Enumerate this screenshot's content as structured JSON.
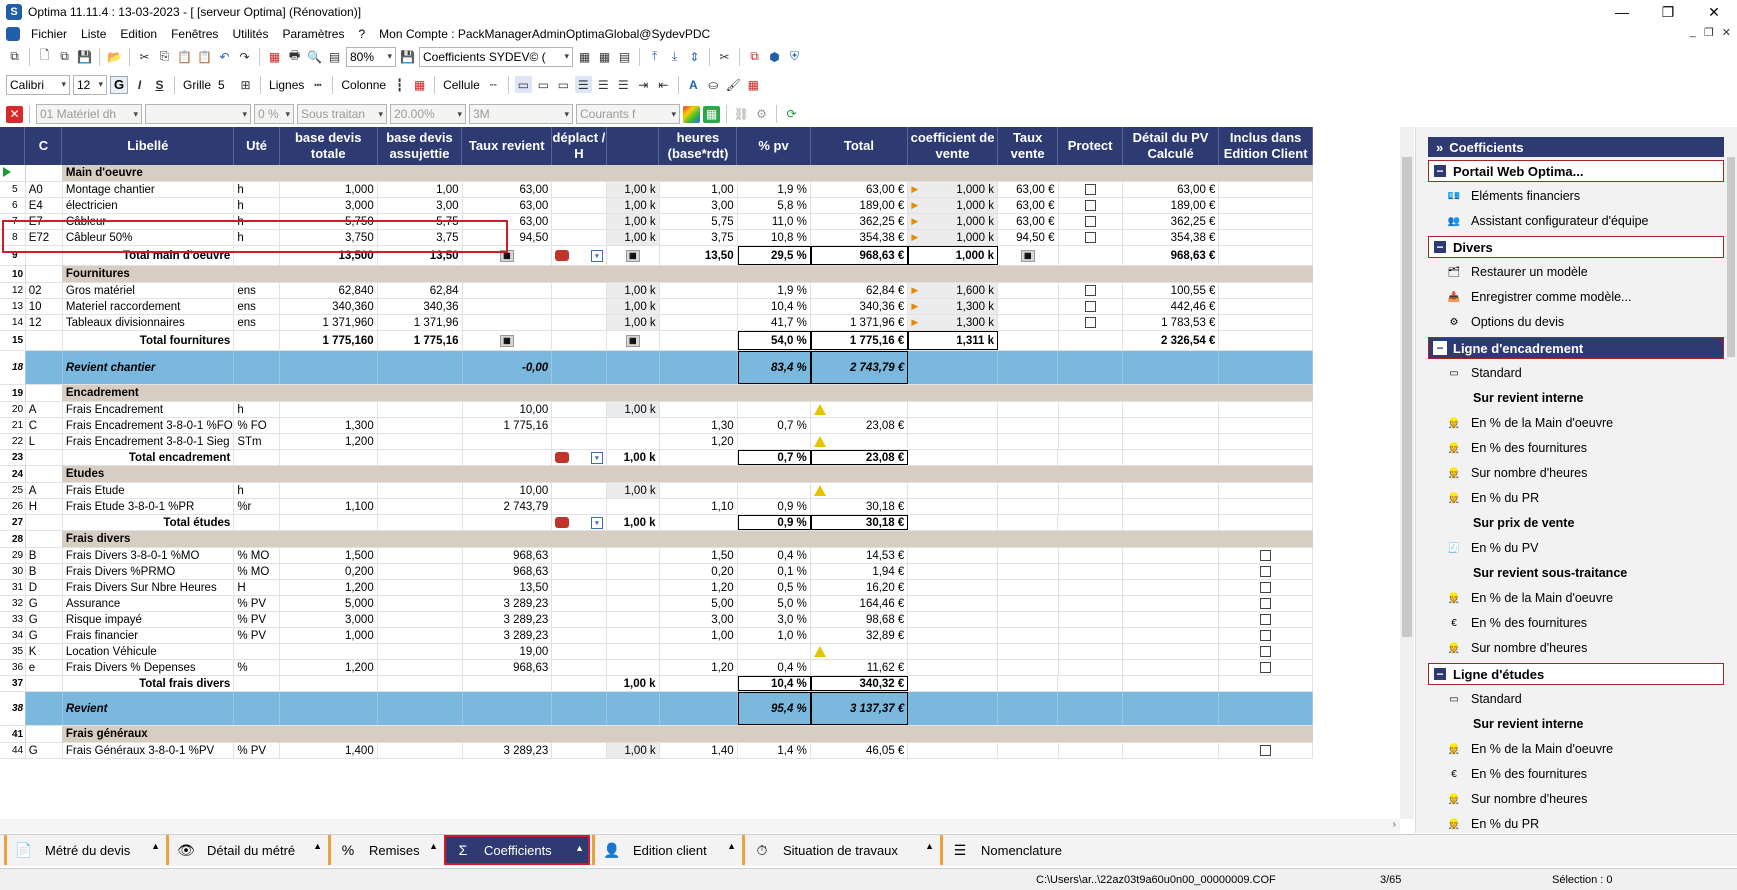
{
  "window": {
    "title": "Optima 11.11.4 : 13-03-2023 - [ [serveur Optima] (Rénovation)]"
  },
  "menu": [
    "Fichier",
    "Liste",
    "Edition",
    "Fenêtres",
    "Utilités",
    "Paramètres",
    "?"
  ],
  "account": "Mon Compte : PackManagerAdminOptimaGlobal@SydevPDC",
  "toolbar1": {
    "zoom": "80%",
    "coef_combo": "Coefficients  SYDEV© ("
  },
  "toolbar2": {
    "font": "Calibri",
    "size": "12",
    "bold": "G",
    "italic": "I",
    "underline": "S",
    "grille": "Grille",
    "grille_val": "5",
    "lignes": "Lignes",
    "colonne": "Colonne",
    "cellule": "Cellule"
  },
  "toolbar3": {
    "c1": "01  Matériel dh",
    "c2": "",
    "c3": "0 %",
    "c4": "Sous traitan",
    "c5": "20.00%",
    "c6": "3M",
    "c7": "Courants f"
  },
  "columns": [
    "C",
    "Libellé",
    "Uté",
    "base devis totale",
    "base devis assujettie",
    "Taux revient",
    "déplact / H",
    "",
    "heures (base*rdt)",
    "% pv",
    "Total",
    "coefficient de vente",
    "Taux vente",
    "Protect",
    "Détail du PV Calculé",
    "Inclus dans Edition Client"
  ],
  "rows": [
    {
      "n": "",
      "type": "sec",
      "c": "",
      "lib": "Main d'oeuvre"
    },
    {
      "n": "5",
      "c": "A0",
      "lib": " Montage chantier",
      "ute": "h",
      "bdt": "1,000",
      "bda": "1,00",
      "tr": "63,00",
      "k": "1,00 k",
      "hr": "1,00",
      "pv": "1,9 %",
      "tot": "63,00 €",
      "cv": "1,000 k",
      "tv": "63,00 €",
      "prot": true,
      "det": "63,00 €"
    },
    {
      "n": "6",
      "c": "E4",
      "lib": " électricien",
      "ute": "h",
      "bdt": "3,000",
      "bda": "3,00",
      "tr": "63,00",
      "k": "1,00 k",
      "hr": "3,00",
      "pv": "5,8 %",
      "tot": "189,00 €",
      "cv": "1,000 k",
      "tv": "63,00 €",
      "prot": true,
      "det": "189,00 €"
    },
    {
      "n": "7",
      "c": "E7",
      "lib": " Câbleur",
      "ute": "h",
      "bdt": "5,750",
      "bda": "5,75",
      "tr": "63,00",
      "k": "1,00 k",
      "hr": "5,75",
      "pv": "11,0 %",
      "tot": "362,25 €",
      "cv": "1,000 k",
      "tv": "63,00 €",
      "prot": true,
      "det": "362,25 €"
    },
    {
      "n": "8",
      "c": "E72",
      "lib": " Câbleur 50%",
      "ute": "h",
      "bdt": "3,750",
      "bda": "3,75",
      "tr": "94,50",
      "k": "1,00 k",
      "hr": "3,75",
      "pv": "10,8 %",
      "tot": "354,38 €",
      "cv": "1,000 k",
      "tv": "94,50 €",
      "prot": true,
      "det": "354,38 €"
    },
    {
      "n": "9",
      "type": "tot",
      "lib": "Total main d'oeuvre",
      "bdt": "13,500",
      "bda": "13,50",
      "hr": "13,50",
      "pv": "29,5 %",
      "tot": "968,63 €",
      "cv": "1,000 k",
      "det": "968,63 €"
    },
    {
      "n": "10",
      "type": "sec",
      "lib": "Fournitures"
    },
    {
      "n": "12",
      "c": "02",
      "lib": " Gros matériel",
      "ute": "ens",
      "bdt": "62,840",
      "bda": "62,84",
      "k": "1,00 k",
      "pv": "1,9 %",
      "tot": "62,84 €",
      "cv": "1,600 k",
      "prot": true,
      "det": "100,55 €"
    },
    {
      "n": "13",
      "c": "10",
      "lib": " Materiel raccordement",
      "ute": "ens",
      "bdt": "340,360",
      "bda": "340,36",
      "k": "1,00 k",
      "pv": "10,4 %",
      "tot": "340,36 €",
      "cv": "1,300 k",
      "prot": true,
      "det": "442,46 €"
    },
    {
      "n": "14",
      "c": "12",
      "lib": " Tableaux divisionnaires",
      "ute": "ens",
      "bdt": "1 371,960",
      "bda": "1 371,96",
      "k": "1,00 k",
      "pv": "41,7 %",
      "tot": "1 371,96 €",
      "cv": "1,300 k",
      "prot": true,
      "det": "1 783,53 €"
    },
    {
      "n": "15",
      "type": "tot",
      "lib": "Total fournitures",
      "bdt": "1 775,160",
      "bda": "1 775,16",
      "pv": "54,0 %",
      "tot": "1 775,16 €",
      "cv": "1,311 k",
      "det": "2 326,54 €"
    },
    {
      "n": "18",
      "type": "blue",
      "lib": "Revient chantier",
      "tr": "-0,00",
      "pv": "83,4 %",
      "tot": "2 743,79 €"
    },
    {
      "n": "19",
      "type": "sec",
      "lib": "Encadrement"
    },
    {
      "n": "20",
      "c": "A",
      "lib": "Frais Encadrement",
      "ute": "h",
      "tr": "10,00",
      "k": "1,00 k",
      "warn": true
    },
    {
      "n": "21",
      "c": "C",
      "lib": "Frais Encadrement 3-8-0-1 %FO",
      "ute": "% FO",
      "bdt": "1,300",
      "tr": "1 775,16",
      "hr": "1,30",
      "pv": "0,7 %",
      "tot": "23,08 €"
    },
    {
      "n": "22",
      "c": "L",
      "lib": "Frais Encadrement 3-8-0-1 Sieg",
      "ute": "STm",
      "bdt": "1,200",
      "hr": "1,20",
      "warn": true
    },
    {
      "n": "23",
      "type": "tot2",
      "lib": "Total encadrement",
      "k": "1,00 k",
      "pv": "0,7 %",
      "tot": "23,08 €"
    },
    {
      "n": "24",
      "type": "sec",
      "lib": "Etudes"
    },
    {
      "n": "25",
      "c": "A",
      "lib": "Frais Etude",
      "ute": "h",
      "tr": "10,00",
      "k": "1,00 k",
      "warn": true
    },
    {
      "n": "26",
      "c": "H",
      "lib": "Frais Etude 3-8-0-1 %PR",
      "ute": "%r",
      "bdt": "1,100",
      "tr": "2 743,79",
      "hr": "1,10",
      "pv": "0,9 %",
      "tot": "30,18 €"
    },
    {
      "n": "27",
      "type": "tot2",
      "lib": "Total études",
      "k": "1,00 k",
      "pv": "0,9 %",
      "tot": "30,18 €"
    },
    {
      "n": "28",
      "type": "sec",
      "lib": "Frais divers"
    },
    {
      "n": "29",
      "c": "B",
      "lib": "Frais Divers 3-8-0-1 %MO",
      "ute": "% MO",
      "bdt": "1,500",
      "tr": "968,63",
      "hr": "1,50",
      "pv": "0,4 %",
      "tot": "14,53 €",
      "inc": true
    },
    {
      "n": "30",
      "c": "B",
      "lib": "Frais Divers %PRMO",
      "ute": "% MO",
      "bdt": "0,200",
      "tr": "968,63",
      "hr": "0,20",
      "pv": "0,1 %",
      "tot": "1,94 €",
      "inc": true
    },
    {
      "n": "31",
      "c": "D",
      "lib": "Frais Divers Sur Nbre Heures",
      "ute": "H",
      "bdt": "1,200",
      "tr": "13,50",
      "hr": "1,20",
      "pv": "0,5 %",
      "tot": "16,20 €",
      "inc": true
    },
    {
      "n": "32",
      "c": "G",
      "lib": "Assurance",
      "ute": "% PV",
      "bdt": "5,000",
      "tr": "3 289,23",
      "hr": "5,00",
      "pv": "5,0 %",
      "tot": "164,46 €",
      "inc": true
    },
    {
      "n": "33",
      "c": "G",
      "lib": "Risque impayé",
      "ute": "% PV",
      "bdt": "3,000",
      "tr": "3 289,23",
      "hr": "3,00",
      "pv": "3,0 %",
      "tot": "98,68 €",
      "inc": true
    },
    {
      "n": "34",
      "c": "G",
      "lib": "Frais financier",
      "ute": "% PV",
      "bdt": "1,000",
      "tr": "3 289,23",
      "hr": "1,00",
      "pv": "1,0 %",
      "tot": "32,89 €",
      "inc": true
    },
    {
      "n": "35",
      "c": "K",
      "lib": "Location Véhicule",
      "tr": "19,00",
      "warn": true,
      "inc": true
    },
    {
      "n": "36",
      "c": "e",
      "lib": "Frais Divers % Depenses",
      "ute": "%",
      "bdt": "1,200",
      "tr": "968,63",
      "hr": "1,20",
      "pv": "0,4 %",
      "tot": "11,62 €",
      "inc": true
    },
    {
      "n": "37",
      "type": "tot3",
      "lib": "Total frais divers",
      "k": "1,00 k",
      "pv": "10,4 %",
      "tot": "340,32 €"
    },
    {
      "n": "38",
      "type": "blue",
      "lib": "Revient",
      "pv": "95,4 %",
      "tot": "3 137,37 €"
    },
    {
      "n": "41",
      "type": "sec",
      "lib": "Frais généraux"
    },
    {
      "n": "44",
      "c": "G",
      "lib": "Frais Généraux 3-8-0-1 %PV",
      "ute": "% PV",
      "bdt": "1,400",
      "tr": "3 289,23",
      "k": "1,00 k",
      "hr": "1,40",
      "pv": "1,4 %",
      "tot": "46,05 €",
      "inc": true
    }
  ],
  "panel": {
    "title": "Coefficients",
    "groups": [
      {
        "label": "Portail Web Optima...",
        "items": [
          {
            "t": "Eléments financiers",
            "i": "💶"
          },
          {
            "t": "Assistant configurateur d'équipe",
            "i": "👥"
          }
        ]
      },
      {
        "label": "Divers",
        "items": [
          {
            "t": "Restaurer un modèle",
            "i": "🗂"
          },
          {
            "t": "Enregistrer comme modèle...",
            "i": "📥"
          },
          {
            "t": "Options du devis",
            "i": "⚙"
          }
        ]
      },
      {
        "label": "Ligne d'encadrement",
        "dark": true,
        "items": [
          {
            "t": "Standard",
            "i": "▭"
          },
          {
            "t": "Sur revient interne",
            "b": true
          },
          {
            "t": "En % de la Main d'oeuvre",
            "i": "👷"
          },
          {
            "t": "En % des fournitures",
            "i": "👷"
          },
          {
            "t": "Sur nombre d'heures",
            "i": "👷"
          },
          {
            "t": "En % du PR",
            "i": "👷"
          },
          {
            "t": "Sur prix de vente",
            "b": true
          },
          {
            "t": "En % du PV",
            "i": "🧾"
          },
          {
            "t": "Sur revient sous-traitance",
            "b": true
          },
          {
            "t": "En % de la Main d'oeuvre",
            "i": "👷"
          },
          {
            "t": "En % des fournitures",
            "i": "€"
          },
          {
            "t": "Sur nombre d'heures",
            "i": "👷"
          }
        ]
      },
      {
        "label": "Ligne d'études",
        "items": [
          {
            "t": "Standard",
            "i": "▭"
          },
          {
            "t": "Sur revient interne",
            "b": true
          },
          {
            "t": "En % de la Main d'oeuvre",
            "i": "👷"
          },
          {
            "t": "En % des fournitures",
            "i": "€"
          },
          {
            "t": "Sur nombre d'heures",
            "i": "👷"
          },
          {
            "t": "En % du PR",
            "i": "👷"
          }
        ]
      }
    ]
  },
  "tabs": [
    {
      "label": "Métré du devis",
      "i": "📄"
    },
    {
      "label": "Détail du métré",
      "i": "👁"
    },
    {
      "label": "Remises",
      "i": "%"
    },
    {
      "label": "Coefficients",
      "i": "Σ",
      "active": true
    },
    {
      "label": "Edition client",
      "i": "👤"
    },
    {
      "label": "Situation de travaux",
      "i": "⏱"
    },
    {
      "label": "Nomenclature",
      "i": "☰"
    }
  ],
  "status": {
    "path": "C:\\Users\\ar..\\22az03t9a60u0n00_00000009.COF",
    "pos": "3/65",
    "selection": "Sélection : 0"
  }
}
